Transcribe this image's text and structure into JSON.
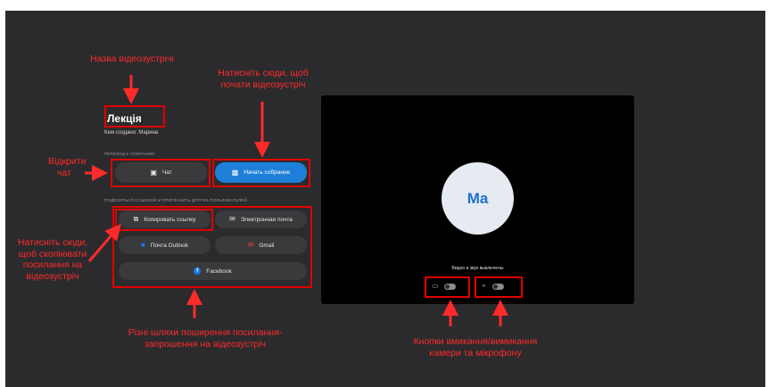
{
  "meeting": {
    "title": "Лекція",
    "created_by": "Кем создано: Марина"
  },
  "join_section": {
    "label": "ПЕРЕХОД К СОБРАНИЮ",
    "chat_button": "Чат",
    "start_button": "Начать собрание"
  },
  "share_section": {
    "label": "ПОДЕЛИТЬСЯ ССЫЛКОЙ И ПРИГЛАСИТЬ ДРУГИХ ПОЛЬЗОВАТЕЛЕЙ",
    "copy_link": "Копировать ссылку",
    "email": "Электронная почта",
    "outlook": "Почта Outlook",
    "gmail": "Gmail",
    "facebook": "Facebook"
  },
  "preview": {
    "avatar_initials": "Ma",
    "status": "Видео и звук выключены",
    "camera_on": false,
    "mic_on": false
  },
  "annotations": {
    "title": "Назва відеозустрічі",
    "start": "Натисніть сюди, щоб почати відеозустріч",
    "chat": "Відкрити чат",
    "copy": "Натисніть сюди, щоб скопіювати посилання на відеозустріч",
    "share": "Різні шляхи поширення посилання-запрошення на відеозустріч",
    "media": "Кнопки вмикання/вимикання камери та мікрофону"
  },
  "icons": {
    "chat": "chat-bubble-icon",
    "start": "video-camera-icon",
    "copy": "copy-icon",
    "email": "envelope-icon",
    "outlook": "outlook-icon",
    "gmail": "gmail-icon",
    "facebook": "facebook-icon",
    "camera": "camera-off-icon",
    "mic": "mic-off-icon"
  },
  "colors": {
    "background": "#2b2b2d",
    "primary_button": "#1e7fd9",
    "annotation": "#ff2a2a"
  }
}
